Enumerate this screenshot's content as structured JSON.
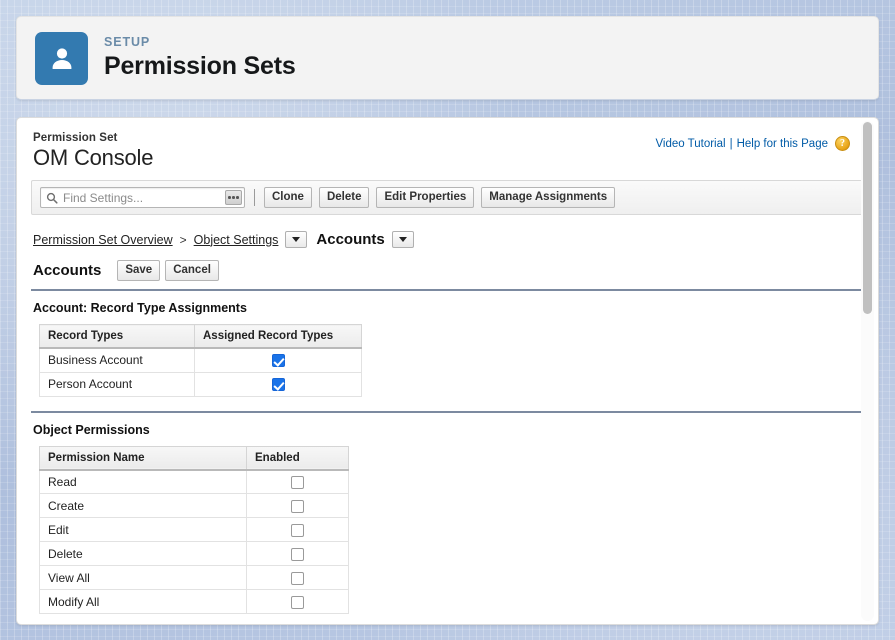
{
  "setup_header": {
    "eyebrow": "SETUP",
    "title": "Permission Sets",
    "icon": "user-icon",
    "icon_color": "#337ab0"
  },
  "page_head": {
    "eyebrow": "Permission Set",
    "title": "OM Console",
    "links": {
      "video_tutorial": "Video Tutorial",
      "separator": "|",
      "help_for_this_page": "Help for this Page",
      "help_icon_glyph": "?",
      "help_icon_color": "#e8a317"
    }
  },
  "toolbar": {
    "search_placeholder": "Find Settings...",
    "search_value": "",
    "search_icon": "search-icon",
    "more_options_icon": "ellipsis-icon",
    "buttons": [
      {
        "label": "Clone"
      },
      {
        "label": "Delete"
      },
      {
        "label": "Edit Properties"
      },
      {
        "label": "Manage Assignments"
      }
    ]
  },
  "breadcrumb": {
    "overview_label": "Permission Set Overview",
    "gt": ">",
    "object_settings_label": "Object Settings",
    "current_label": "Accounts",
    "caret_icon": "chevron-down-icon"
  },
  "section": {
    "title": "Accounts",
    "save_label": "Save",
    "cancel_label": "Cancel"
  },
  "record_type_assignments": {
    "title": "Account: Record Type Assignments",
    "columns": [
      "Record Types",
      "Assigned Record Types"
    ],
    "rows": [
      {
        "name": "Business Account",
        "assigned": true
      },
      {
        "name": "Person Account",
        "assigned": true
      }
    ]
  },
  "object_permissions": {
    "title": "Object Permissions",
    "columns": [
      "Permission Name",
      "Enabled"
    ],
    "rows": [
      {
        "name": "Read",
        "enabled": false
      },
      {
        "name": "Create",
        "enabled": false
      },
      {
        "name": "Edit",
        "enabled": false
      },
      {
        "name": "Delete",
        "enabled": false
      },
      {
        "name": "View All",
        "enabled": false
      },
      {
        "name": "Modify All",
        "enabled": false
      }
    ]
  },
  "colors": {
    "accent_blue": "#337ab0",
    "link_blue": "#015ba7",
    "checkbox_blue": "#1a73e8",
    "page_background": "#b6c7e3"
  }
}
